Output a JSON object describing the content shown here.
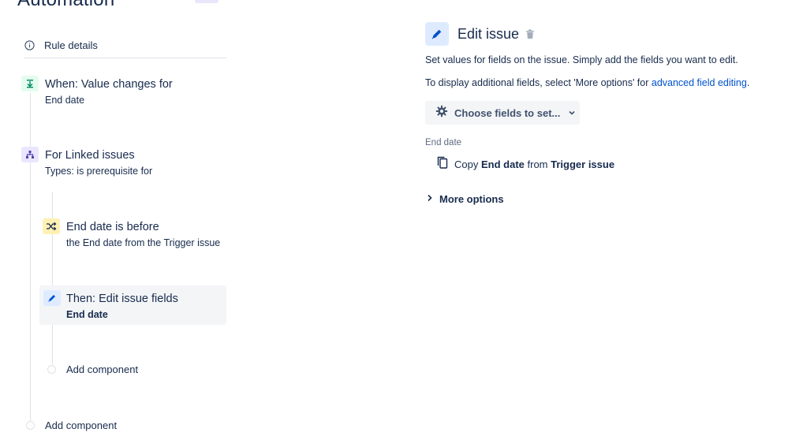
{
  "page": {
    "title": "Automation"
  },
  "rule": {
    "details_label": "Rule details",
    "trigger": {
      "title": "When: Value changes for",
      "subtitle": "End date",
      "icon": "arrow-to-bottom-icon"
    },
    "branch": {
      "title": "For Linked issues",
      "subtitle": "Types: is prerequisite for",
      "icon": "hierarchy-icon"
    },
    "condition": {
      "title": "End date is before",
      "subtitle": "the End date from the Trigger issue",
      "icon": "shuffle-icon"
    },
    "action": {
      "title": "Then: Edit issue fields",
      "subtitle": "End date",
      "icon": "pencil-icon"
    },
    "add_component_inner": "Add component",
    "add_component_outer": "Add component"
  },
  "editor": {
    "title": "Edit issue",
    "description_1": "Set values for fields on the issue. Simply add the fields you want to edit.",
    "description_2_prefix": "To display additional fields, select 'More options' for ",
    "description_2_link": "advanced field editing",
    "description_2_suffix": ".",
    "choose_fields_label": "Choose fields to set...",
    "field": {
      "label": "End date",
      "copy_word": "Copy",
      "field_name": "End date",
      "from_word": "from",
      "source": "Trigger issue"
    },
    "more_options_label": "More options"
  },
  "colors": {
    "trigger_bg": "#e3fcef",
    "trigger_fg": "#00875a",
    "branch_bg": "#eae6ff",
    "branch_fg": "#5243aa",
    "condition_bg": "#fff0b3",
    "condition_fg": "#172b4d",
    "action_bg": "#deebff",
    "action_fg": "#0052cc",
    "link": "#0052cc"
  }
}
